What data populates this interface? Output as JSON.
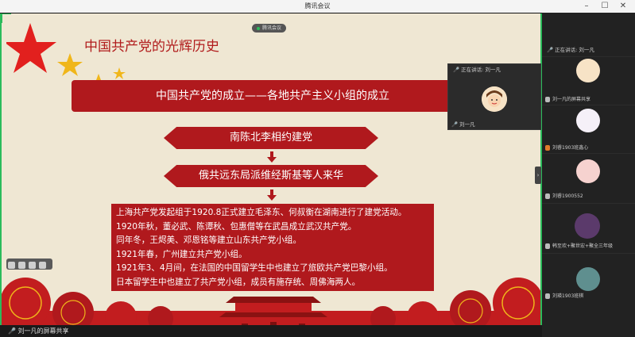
{
  "window": {
    "title": "腾讯会议"
  },
  "share_indicator": "腾讯会议",
  "slide": {
    "title": "中国共产党的光辉历史",
    "banner": "中国共产党的成立——各地共产主义小组的成立",
    "step1": "南陈北李相约建党",
    "step2": "俄共远东局派维经斯基等人来华",
    "lines": [
      "上海共产党发起组于1920.8正式建立毛泽东、何叔衡在湖南进行了建党活动。",
      "1920年秋，董必武、陈谭秋、包惠僧等在武昌成立武汉共产党。",
      "同年冬，王烬美、邓恩铭等建立山东共产党小组。",
      "1921年春，广州建立共产党小组。",
      "1921年3、4月间，在法国的中国留学生中也建立了旅欧共产党巴黎小组。",
      "日本留学生中也建立了共产党小组，成员有施存统、周佛海两人。"
    ]
  },
  "pip": {
    "header": "正在讲话: 刘一凡",
    "name": "刘一凡"
  },
  "sidebar": {
    "speaking": "正在讲话: 刘一凡",
    "tiles": [
      {
        "label": "刘一凡的屏幕共享"
      },
      {
        "label": "刘睿1903班鑫心"
      },
      {
        "label": "刘睿1900552"
      },
      {
        "label": "韩至欢+聚世宏+聚全三年级"
      },
      {
        "label": "刘瑛1903班棋"
      }
    ]
  },
  "bottom_name": "刘一凡的屏幕共享",
  "colors": {
    "accent_red": "#b0191d",
    "share_green": "#2bbb5b",
    "slide_bg": "#efe7d3"
  }
}
